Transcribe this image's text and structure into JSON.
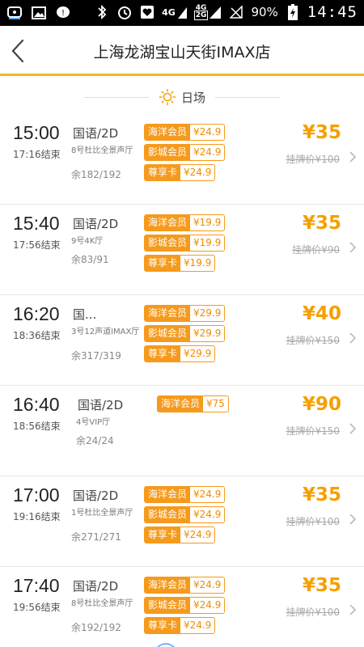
{
  "status_bar": {
    "battery": "90%",
    "time": "14:45",
    "net_top": "4G",
    "net_bottom": "2G",
    "net_label": "4G"
  },
  "header": {
    "title": "上海龙湖宝山天街IMAX店"
  },
  "section": {
    "label": "日场"
  },
  "showtimes": [
    {
      "start": "15:00",
      "end": "17:16结束",
      "lang": "国语/2D",
      "hall": "8号杜比全景声厅",
      "seats": "余182/192",
      "offers": [
        {
          "name": "海洋会员",
          "price": "¥24.9"
        },
        {
          "name": "影城会员",
          "price": "¥24.9"
        },
        {
          "name": "尊享卡",
          "price": "¥24.9"
        }
      ],
      "price": "¥35",
      "list_price": "挂牌价¥100"
    },
    {
      "start": "15:40",
      "end": "17:56结束",
      "lang": "国语/2D",
      "hall": "9号4K厅",
      "seats": "余83/91",
      "offers": [
        {
          "name": "海洋会员",
          "price": "¥19.9"
        },
        {
          "name": "影城会员",
          "price": "¥19.9"
        },
        {
          "name": "尊享卡",
          "price": "¥19.9"
        }
      ],
      "price": "¥35",
      "list_price": "挂牌价¥90"
    },
    {
      "start": "16:20",
      "end": "18:36结束",
      "lang": "国...",
      "hall": "3号12声道IMAX厅",
      "seats": "余317/319",
      "offers": [
        {
          "name": "海洋会员",
          "price": "¥29.9"
        },
        {
          "name": "影城会员",
          "price": "¥29.9"
        },
        {
          "name": "尊享卡",
          "price": "¥29.9"
        }
      ],
      "price": "¥40",
      "list_price": "挂牌价¥150"
    },
    {
      "start": "16:40",
      "end": "18:56结束",
      "lang": "国语/2D",
      "hall": "4号VIP厅",
      "seats": "余24/24",
      "offers": [
        {
          "name": "海洋会员",
          "price": "¥75"
        }
      ],
      "price": "¥90",
      "list_price": "挂牌价¥150"
    },
    {
      "start": "17:00",
      "end": "19:16结束",
      "lang": "国语/2D",
      "hall": "1号杜比全景声厅",
      "seats": "余271/271",
      "offers": [
        {
          "name": "海洋会员",
          "price": "¥24.9"
        },
        {
          "name": "影城会员",
          "price": "¥24.9"
        },
        {
          "name": "尊享卡",
          "price": "¥24.9"
        }
      ],
      "price": "¥35",
      "list_price": "挂牌价¥100"
    },
    {
      "start": "17:40",
      "end": "19:56结束",
      "lang": "国语/2D",
      "hall": "8号杜比全景声厅",
      "seats": "余192/192",
      "offers": [
        {
          "name": "海洋会员",
          "price": "¥24.9"
        },
        {
          "name": "影城会员",
          "price": "¥24.9"
        },
        {
          "name": "尊享卡",
          "price": "¥24.9"
        }
      ],
      "price": "¥35",
      "list_price": "挂牌价¥100"
    }
  ],
  "colors": {
    "accent": "#f5a000",
    "tag": "#f59a1c",
    "header_border": "#f5b62e"
  }
}
